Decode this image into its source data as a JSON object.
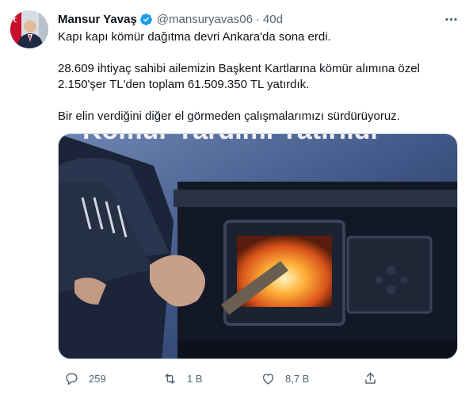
{
  "author": {
    "name": "Mansur Yavaş",
    "handle": "@mansuryavas06",
    "separator": "·",
    "time": "40d"
  },
  "icons": {
    "verified": "verified-badge-icon",
    "more": "more-options-icon",
    "reply": "reply-icon",
    "retweet": "retweet-icon",
    "like": "heart-icon",
    "share": "share-icon"
  },
  "colors": {
    "accent": "#1d9bf0",
    "text": "#0f1419",
    "muted": "#536471"
  },
  "tweet": {
    "line1": "Kapı kapı kömür dağıtma devri Ankara'da sona erdi.",
    "line2": "28.609 ihtiyaç sahibi ailemizin Başkent Kartlarına kömür alımına özel",
    "line3": "2.150'şer TL'den toplam 61.509.350 TL yatırdık.",
    "line4": "Bir elin verdiğini diğer el görmeden çalışmalarımızı sürdürüyoruz."
  },
  "media": {
    "overlay_text": "Kömür Yardımı Yatırıldı"
  },
  "stats": {
    "replies": "259",
    "retweets": "1 B",
    "likes": "8,7 B"
  }
}
